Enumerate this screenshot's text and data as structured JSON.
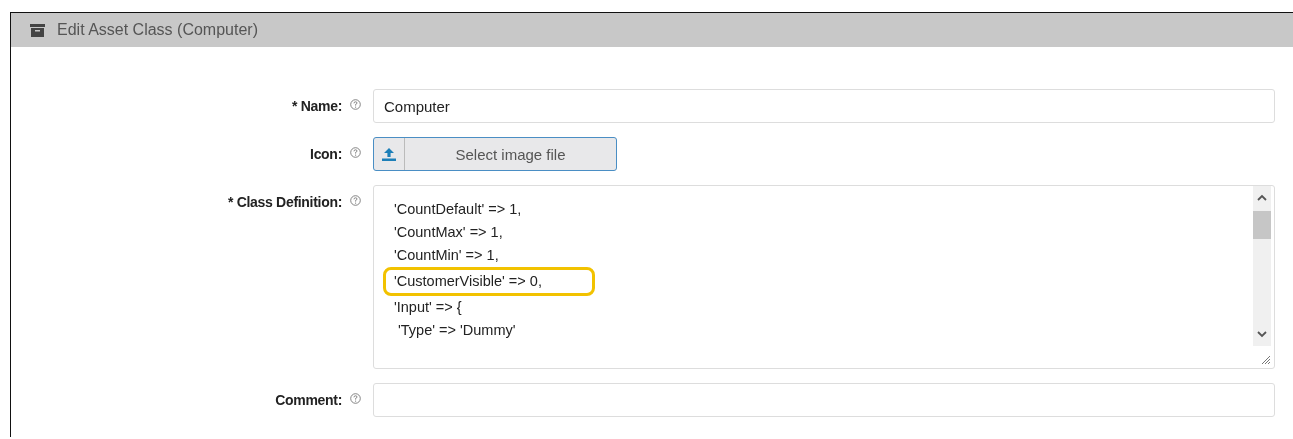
{
  "panel": {
    "title": "Edit Asset Class (Computer)"
  },
  "fields": [
    {
      "kind": "text",
      "label": "* Name:",
      "value": "Computer"
    },
    {
      "kind": "file",
      "label": "Icon:",
      "button": "Select image file"
    },
    {
      "kind": "code",
      "label": "* Class Definition:",
      "lines": [
        {
          "text": "'CountDefault' => 1,",
          "highlighted": false
        },
        {
          "text": "'CountMax' => 1,",
          "highlighted": false
        },
        {
          "text": "'CountMin' => 1,",
          "highlighted": false
        },
        {
          "text": "'CustomerVisible' => 0,",
          "highlighted": true
        },
        {
          "text": "'Input' => {",
          "highlighted": false
        },
        {
          "text": " 'Type' => 'Dummy'",
          "highlighted": false
        }
      ]
    },
    {
      "kind": "text",
      "label": "Comment:"
    }
  ]
}
